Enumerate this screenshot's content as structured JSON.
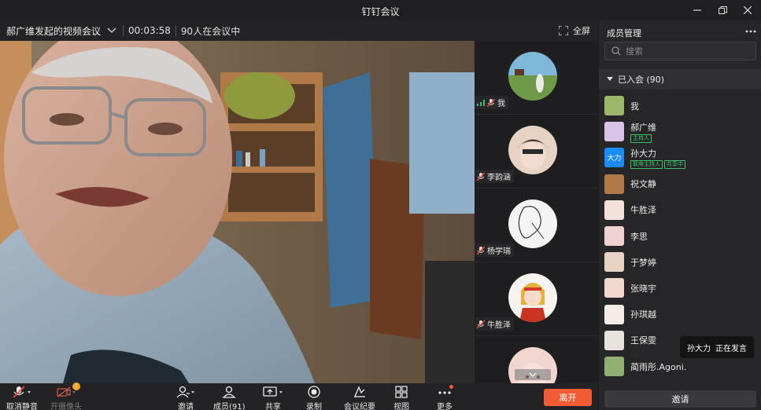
{
  "window": {
    "title": "钉钉会议"
  },
  "meeting": {
    "name": "郝广维发起的视频会议",
    "timer": "00:03:58",
    "participant_status": "90人在会议中",
    "fullscreen_label": "全屏"
  },
  "thumbnails": [
    {
      "name": "我"
    },
    {
      "name": "李韵涵"
    },
    {
      "name": "杨学瑞"
    },
    {
      "name": "牛胜泽"
    },
    {
      "name": ""
    }
  ],
  "toolbar": {
    "unmute": "取消静音",
    "camera": "开摄像头",
    "camera_badge": "!",
    "invite": "邀请",
    "members": "成员(91)",
    "share": "共享",
    "record": "录制",
    "minutes": "会议纪要",
    "view": "视图",
    "more": "更多",
    "leave": "离开"
  },
  "panel": {
    "title": "成员管理",
    "search_placeholder": "搜索",
    "group_label": "已入会 (90)",
    "invite": "邀请",
    "members": [
      {
        "name": "我",
        "tags": []
      },
      {
        "name": "郝广维",
        "tags": [
          "主持人"
        ]
      },
      {
        "name": "孙大力",
        "avatar_text": "大力",
        "tags": [
          "联席主持人",
          "共享中"
        ]
      },
      {
        "name": "祝文静",
        "tags": []
      },
      {
        "name": "牛胜泽",
        "tags": []
      },
      {
        "name": "李思",
        "tags": []
      },
      {
        "name": "于梦婷",
        "tags": []
      },
      {
        "name": "张晓宇",
        "tags": []
      },
      {
        "name": "孙琪越",
        "tags": []
      },
      {
        "name": "王保雯",
        "tags": []
      },
      {
        "name": "蔺雨彤.Agoni.",
        "tags": []
      }
    ]
  },
  "speaking": {
    "name": "孙大力",
    "status": "正在发言"
  },
  "colors": {
    "accent": "#f25c35",
    "tag_green": "#3ec16a",
    "brand_blue": "#1a8cff"
  }
}
